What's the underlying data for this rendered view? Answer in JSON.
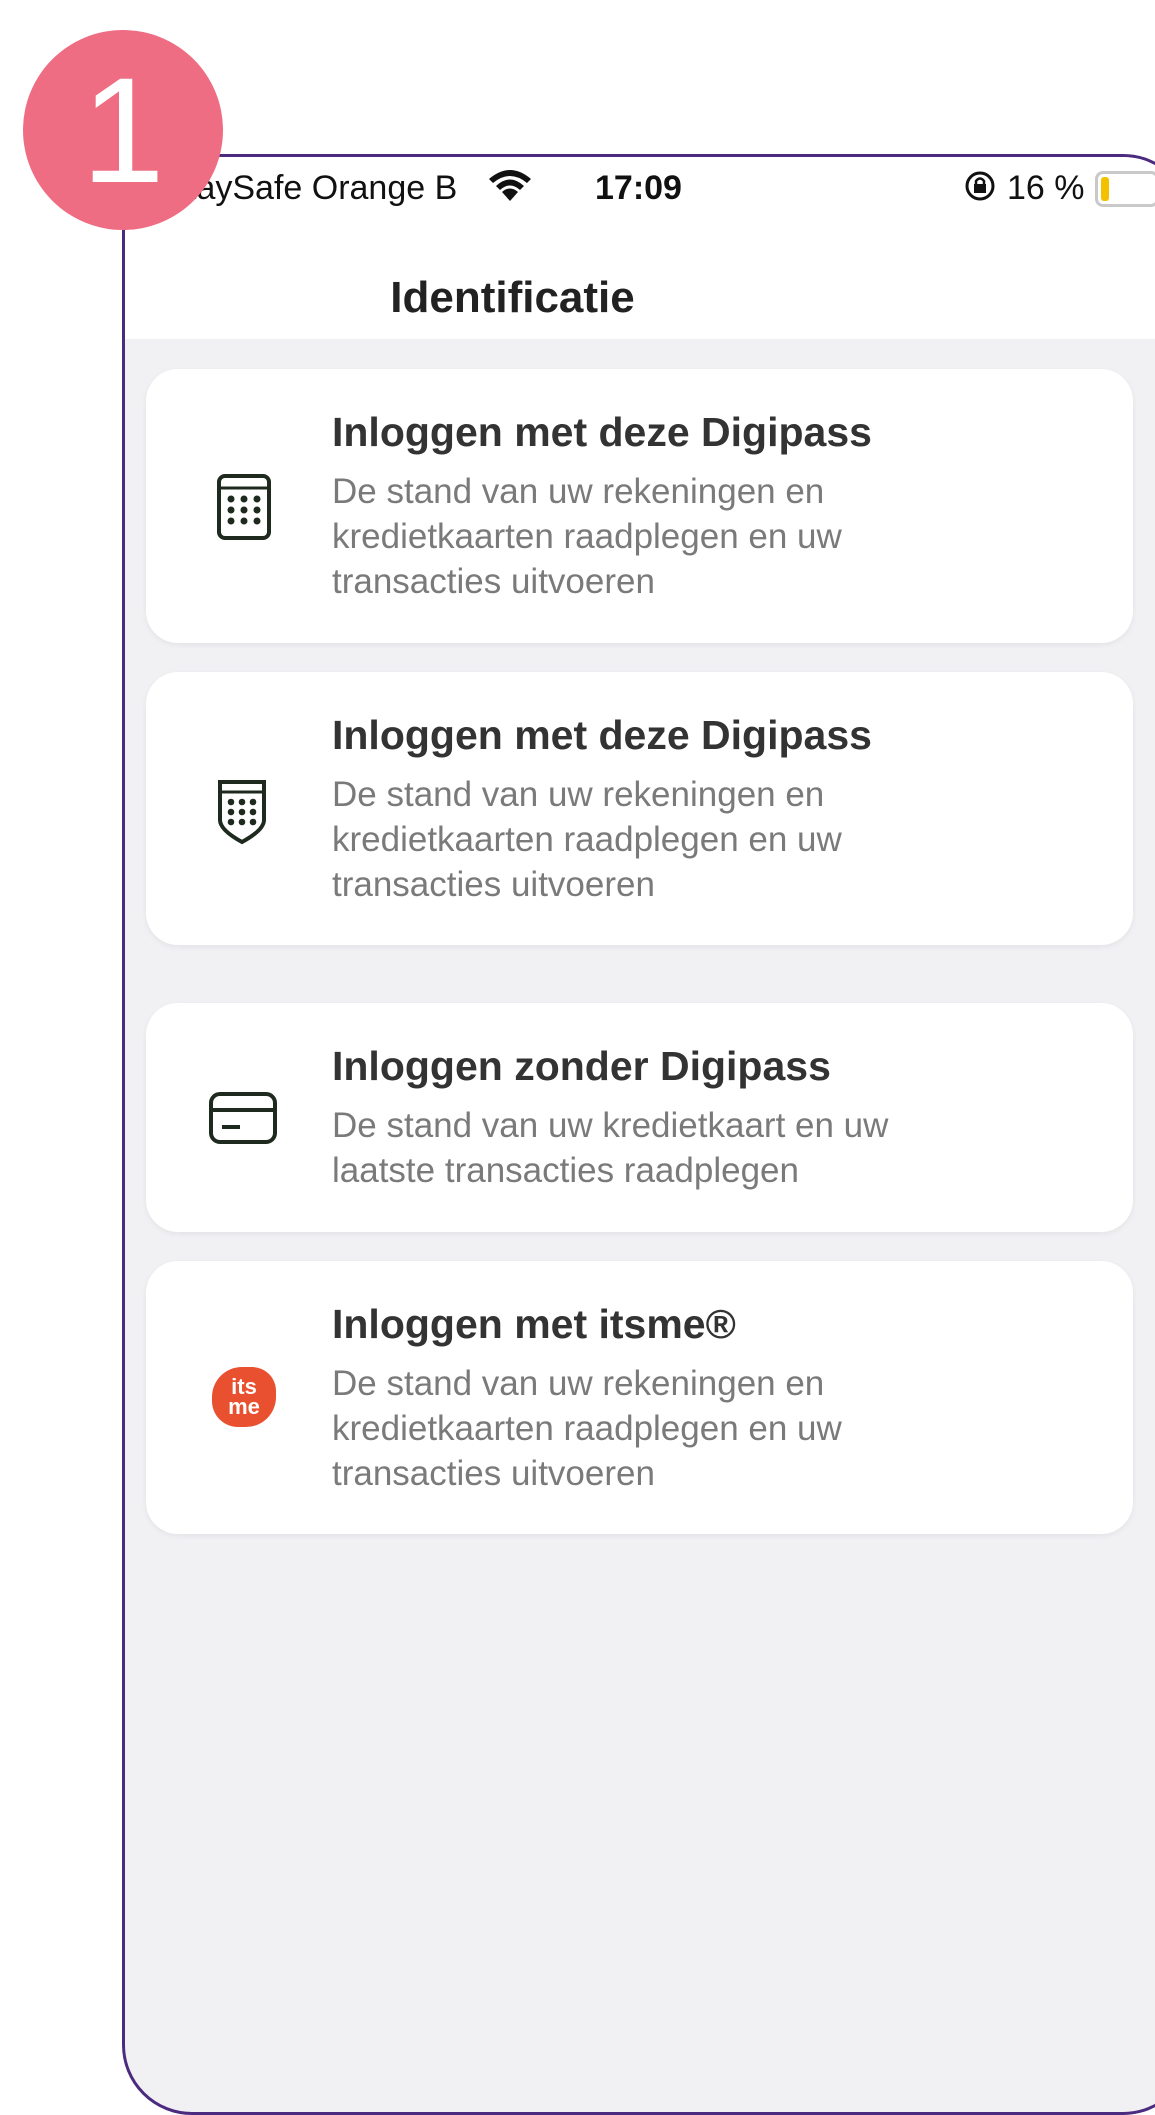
{
  "step_badge": "1",
  "status_bar": {
    "carrier": "taySafe Orange B",
    "time": "17:09",
    "battery_percent": "16 %",
    "battery_level": 0.16,
    "icons": [
      "wifi-icon",
      "orientation-lock-icon",
      "battery-icon"
    ]
  },
  "nav": {
    "title": "Identificatie"
  },
  "options": [
    {
      "title": "Inloggen met deze Digipass",
      "description": "De stand van uw rekeningen en kredietkaarten raadplegen en uw transacties uitvoeren",
      "icon": "digipass-calculator-icon"
    },
    {
      "title": "Inloggen met deze Digipass",
      "description": "De stand van uw rekeningen en kredietkaarten raadplegen en uw transacties uitvoeren",
      "icon": "digipass-shield-icon"
    },
    {
      "title": "Inloggen zonder Digipass",
      "description": "De stand van uw kredietkaart en uw laatste transacties raadplegen",
      "icon": "credit-card-icon"
    },
    {
      "title": "Inloggen met itsme®",
      "description": "De stand van uw rekeningen en kredietkaarten raadplegen en uw transacties uitvoeren",
      "icon": "itsme-icon",
      "icon_text_top": "its",
      "icon_text_bottom": "me"
    }
  ],
  "colors": {
    "frame": "#4b2b7f",
    "badge": "#ef6d83",
    "itsme": "#e8502f",
    "background": "#f1f1f4"
  }
}
